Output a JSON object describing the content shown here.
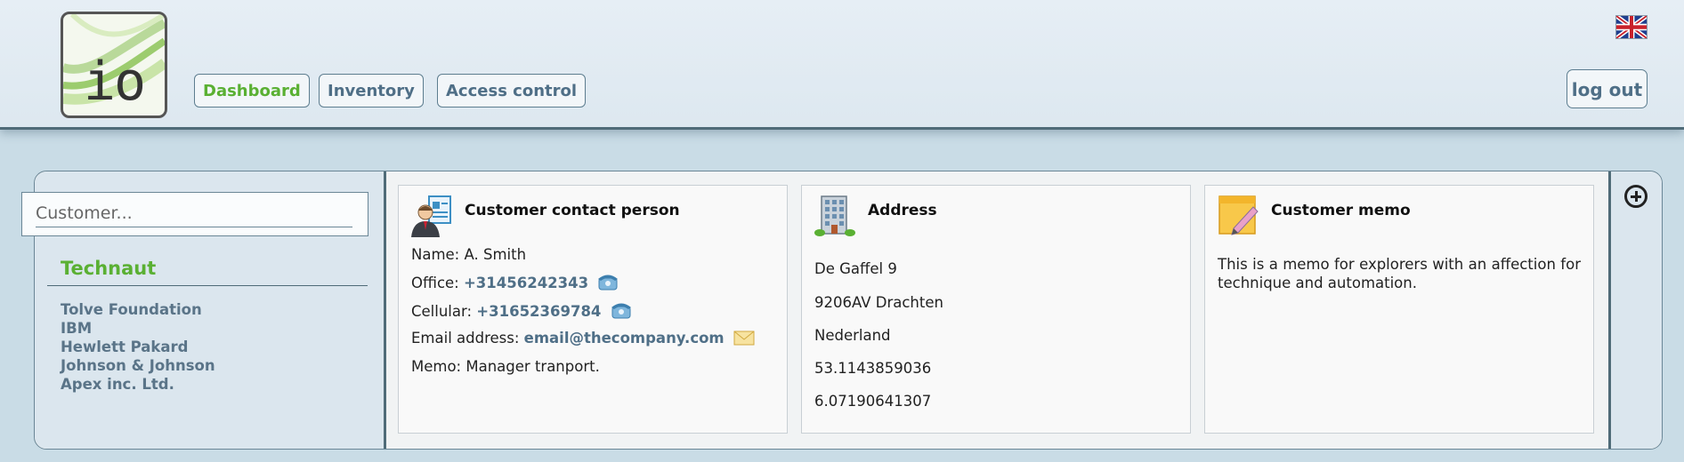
{
  "header": {
    "logo_text": "io",
    "nav": [
      {
        "label": "Dashboard",
        "active": true
      },
      {
        "label": "Inventory",
        "active": false
      },
      {
        "label": "Access control",
        "active": false
      }
    ],
    "language_icon": "uk-flag-icon",
    "logout_label": "log out"
  },
  "sidebar": {
    "search_placeholder": "Customer...",
    "selected_customer": "Technaut",
    "customers": [
      "Tolve Foundation",
      "IBM",
      "Hewlett Pakard",
      "Johnson & Johnson",
      "Apex inc. Ltd."
    ]
  },
  "contact": {
    "title": "Customer contact person",
    "name_label": "Name:",
    "name": "A. Smith",
    "office_label": "Office:",
    "office": "+31456242343",
    "cellular_label": "Cellular:",
    "cellular": "+31652369784",
    "email_label": "Email address:",
    "email": "email@thecompany.com",
    "memo_label": "Memo:",
    "memo": "Manager tranport."
  },
  "address": {
    "title": "Address",
    "lines": [
      "De Gaffel 9",
      "9206AV Drachten",
      "Nederland",
      "53.1143859036",
      "6.07190641307"
    ]
  },
  "memo": {
    "title": "Customer memo",
    "text": "This is a memo for explorers with an affection for technique and automation."
  },
  "colors": {
    "accent_green": "#5ab033",
    "link_blue": "#4f6f87",
    "border_dark": "#4f6b78",
    "background": "#c9dce6"
  }
}
